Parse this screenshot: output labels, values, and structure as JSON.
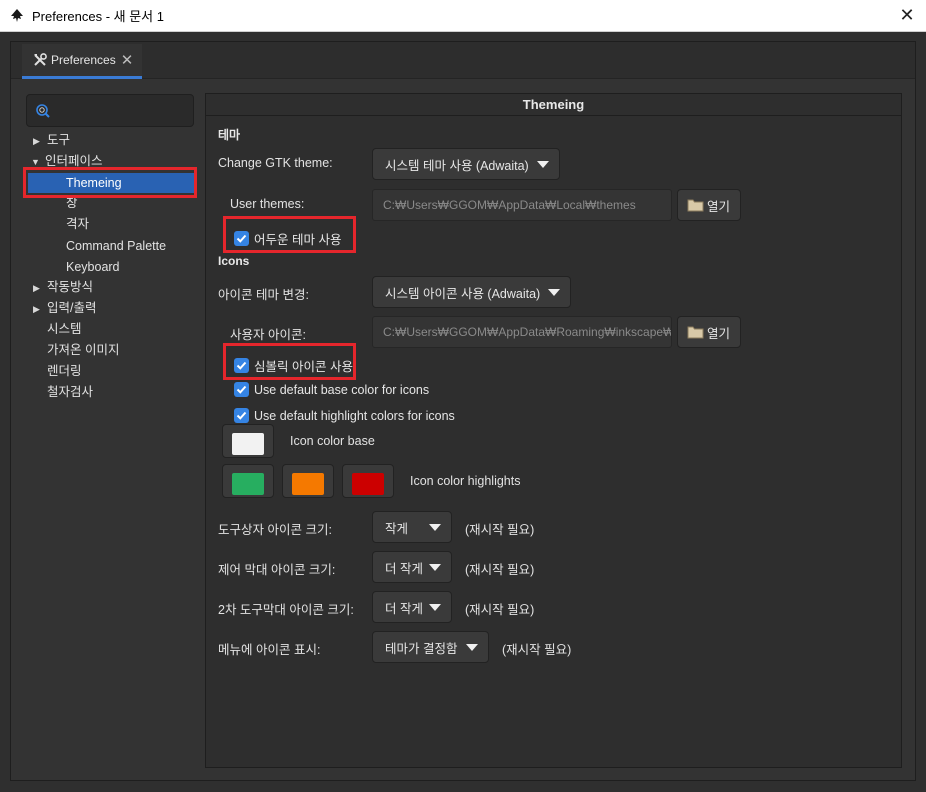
{
  "window": {
    "title": "Preferences - 새 문서 1",
    "close_glyph": "✕"
  },
  "tab": {
    "label": "Preferences",
    "close_glyph": "✕"
  },
  "search": {
    "placeholder": ""
  },
  "sidebar": {
    "items": [
      {
        "label": "도구",
        "expander": "collapsed"
      },
      {
        "label": "인터페이스",
        "expander": "expanded"
      },
      {
        "label": "Themeing",
        "selected": true
      },
      {
        "label": "창"
      },
      {
        "label": "격자"
      },
      {
        "label": "Command Palette"
      },
      {
        "label": "Keyboard"
      },
      {
        "label": "작동방식",
        "expander": "collapsed"
      },
      {
        "label": "입력/출력",
        "expander": "collapsed"
      },
      {
        "label": "시스템"
      },
      {
        "label": "가져온 이미지"
      },
      {
        "label": "렌더링"
      },
      {
        "label": "철자검사"
      }
    ]
  },
  "panel": {
    "title": "Themeing",
    "theme_section": "테마",
    "gtk_theme_label": "Change GTK theme:",
    "gtk_theme_value": "시스템 테마 사용 (Adwaita)",
    "user_themes_label": "User themes:",
    "user_themes_path": "C:₩Users₩GGOM₩AppData₩Local₩themes",
    "open_label": "열기",
    "dark_theme_label": "어두운 테마 사용",
    "dark_theme_checked": true,
    "icons_section": "Icons",
    "icon_theme_label": "아이콘 테마 변경:",
    "icon_theme_value": "시스템 아이콘 사용 (Adwaita)",
    "user_icons_label": "사용자 아이콘:",
    "user_icons_path": "C:₩Users₩GGOM₩AppData₩Roaming₩inkscape₩icc",
    "symbolic_icons_label": "심볼릭 아이콘 사용",
    "symbolic_icons_checked": true,
    "default_base_label": "Use default base color for icons",
    "default_base_checked": true,
    "default_highlight_label": "Use default highlight colors for icons",
    "default_highlight_checked": true,
    "icon_color_base_label": "Icon color base",
    "icon_color_highlights_label": "Icon color highlights",
    "colors": {
      "base": "#f2f2f2",
      "highlight1": "#27ae60",
      "highlight2": "#f57900",
      "highlight3": "#cc0000"
    },
    "toolbox_icon_size_label": "도구상자 아이콘 크기:",
    "toolbox_icon_size_value": "작게",
    "control_bar_icon_size_label": "제어 막대 아이콘 크기:",
    "control_bar_icon_size_value": "더 작게",
    "secondary_toolbar_icon_size_label": "2차 도구막대 아이콘 크기:",
    "secondary_toolbar_icon_size_value": "더 작게",
    "menu_icons_label": "메뉴에 아이콘 표시:",
    "menu_icons_value": "테마가 결정함",
    "restart_required": "(재시작 필요)"
  },
  "accent": {
    "selection": "#2962b3",
    "checkbox": "#3584e4",
    "highlight_box": "#e5262c"
  }
}
